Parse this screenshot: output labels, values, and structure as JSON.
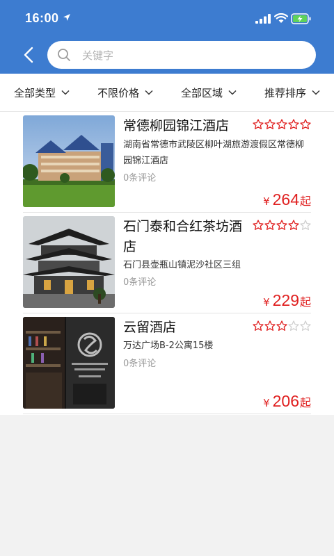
{
  "status_bar": {
    "time": "16:00"
  },
  "search": {
    "placeholder": "关键字",
    "value": ""
  },
  "filters": [
    {
      "label": "全部类型"
    },
    {
      "label": "不限价格"
    },
    {
      "label": "全部区域"
    },
    {
      "label": "推荐排序"
    }
  ],
  "hotels": [
    {
      "name": "常德柳园锦江酒店",
      "rating": 5,
      "address": "湖南省常德市武陵区柳叶湖旅游渡假区常德柳园锦江酒店",
      "reviews": "0条评论",
      "price_symbol": "¥",
      "price": "264",
      "price_suffix": "起"
    },
    {
      "name": "石门泰和合红茶坊酒店",
      "rating": 4,
      "address": "石门县壶瓶山镇泥沙社区三组",
      "reviews": "0条评论",
      "price_symbol": "¥",
      "price": "229",
      "price_suffix": "起"
    },
    {
      "name": "云留酒店",
      "rating": 3,
      "address": "万达广场B-2公寓15楼",
      "reviews": "0条评论",
      "price_symbol": "¥",
      "price": "206",
      "price_suffix": "起"
    }
  ],
  "colors": {
    "header": "#3d7cd0",
    "price": "#e02020",
    "star": "#e02020",
    "star_empty": "#d0d0d0"
  }
}
